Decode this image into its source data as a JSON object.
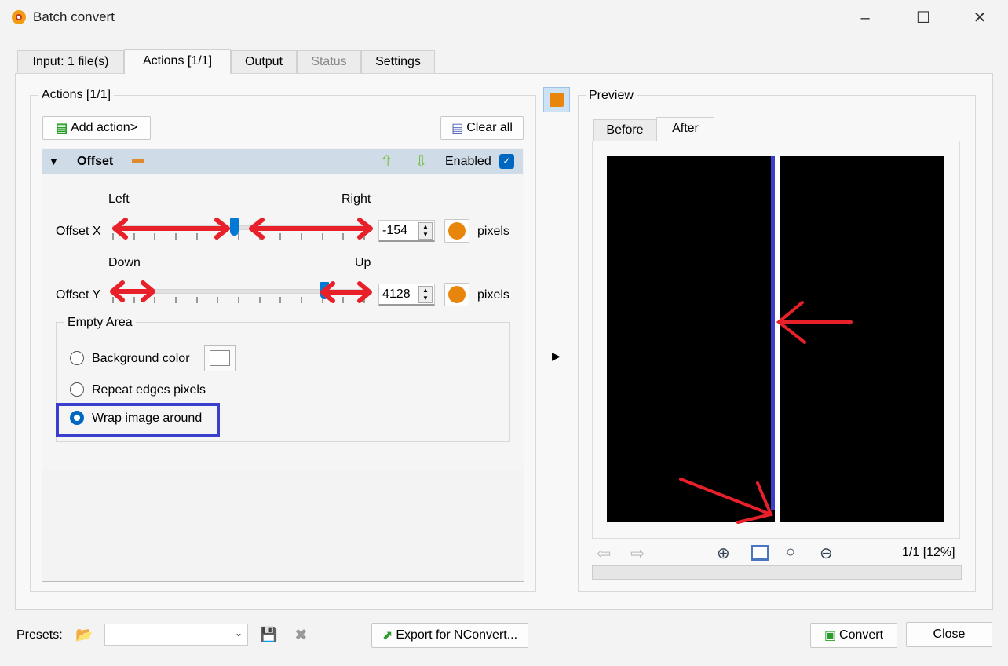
{
  "window": {
    "title": "Batch convert"
  },
  "tabs": [
    {
      "label": "Input: 1 file(s)"
    },
    {
      "label": "Actions [1/1]"
    },
    {
      "label": "Output"
    },
    {
      "label": "Status"
    },
    {
      "label": "Settings"
    }
  ],
  "actions": {
    "group_label": "Actions [1/1]",
    "add_action": "Add action>",
    "clear_all": "Clear all",
    "item": {
      "name": "Offset",
      "enabled_label": "Enabled",
      "enabled": true
    },
    "offset_x": {
      "label": "Offset X",
      "left": "Left",
      "right": "Right",
      "value": "-154",
      "unit": "pixels",
      "slider_fraction": 0.48
    },
    "offset_y": {
      "label": "Offset Y",
      "low": "Down",
      "high": "Up",
      "value": "4128",
      "unit": "pixels",
      "slider_fraction": 0.84
    },
    "empty_area": {
      "label": "Empty Area",
      "options": [
        {
          "label": "Background color",
          "selected": false
        },
        {
          "label": "Repeat edges pixels",
          "selected": false
        },
        {
          "label": "Wrap image around",
          "selected": true
        }
      ]
    }
  },
  "preview": {
    "label": "Preview",
    "tabs": [
      {
        "label": "Before"
      },
      {
        "label": "After"
      }
    ],
    "page_zoom": "1/1 [12%]"
  },
  "footer": {
    "presets_label": "Presets:",
    "preset_value": "",
    "export": "Export for NConvert...",
    "convert": "Convert",
    "close": "Close"
  },
  "colors": {
    "accent": "#0067c0",
    "annotation_red": "#e8202a",
    "annotation_blue": "#3b3fcf"
  }
}
